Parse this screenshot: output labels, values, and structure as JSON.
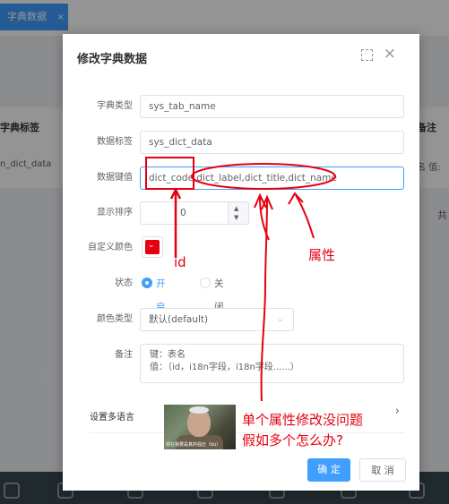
{
  "background": {
    "tab_label": "字典数据",
    "tab_close": "×",
    "table_header_left": "字典标签",
    "table_cell_left": "n_dict_data",
    "table_header_right": "备注",
    "table_cell_right": "名 值: ",
    "right_mid_text": "共"
  },
  "dialog": {
    "title": "修改字典数据",
    "close_glyph": "×",
    "fields": {
      "dict_type": {
        "label": "字典类型",
        "value": "sys_tab_name"
      },
      "dict_label": {
        "label": "数据标签",
        "value": "sys_dict_data"
      },
      "dict_value": {
        "label": "数据键值",
        "value": "dict_code,dict_label,dict_title,dict_name"
      },
      "sort": {
        "label": "显示排序",
        "value": "0"
      },
      "color": {
        "label": "自定义颜色",
        "value": "#e60012"
      },
      "status": {
        "label": "状态",
        "option_on": "开启",
        "option_off": "关闭",
        "selected": "开启"
      },
      "color_type": {
        "label": "颜色类型",
        "value": "默认(default)"
      },
      "remark": {
        "label": "备注",
        "value": "键：表名\n值：（id，i18n字段，i18n字段......）"
      }
    },
    "multilang": {
      "label": "设置多语言",
      "chevron": "›"
    },
    "buttons": {
      "confirm": "确 定",
      "cancel": "取 消"
    }
  },
  "annotations": {
    "color": "#e60012",
    "label_id": "id",
    "label_attr": "属性",
    "note_line1": "单个属性修改没问题",
    "note_line2": "假如多个怎么办?",
    "photo_caption": "现在我要是真的强壮（bù）"
  }
}
